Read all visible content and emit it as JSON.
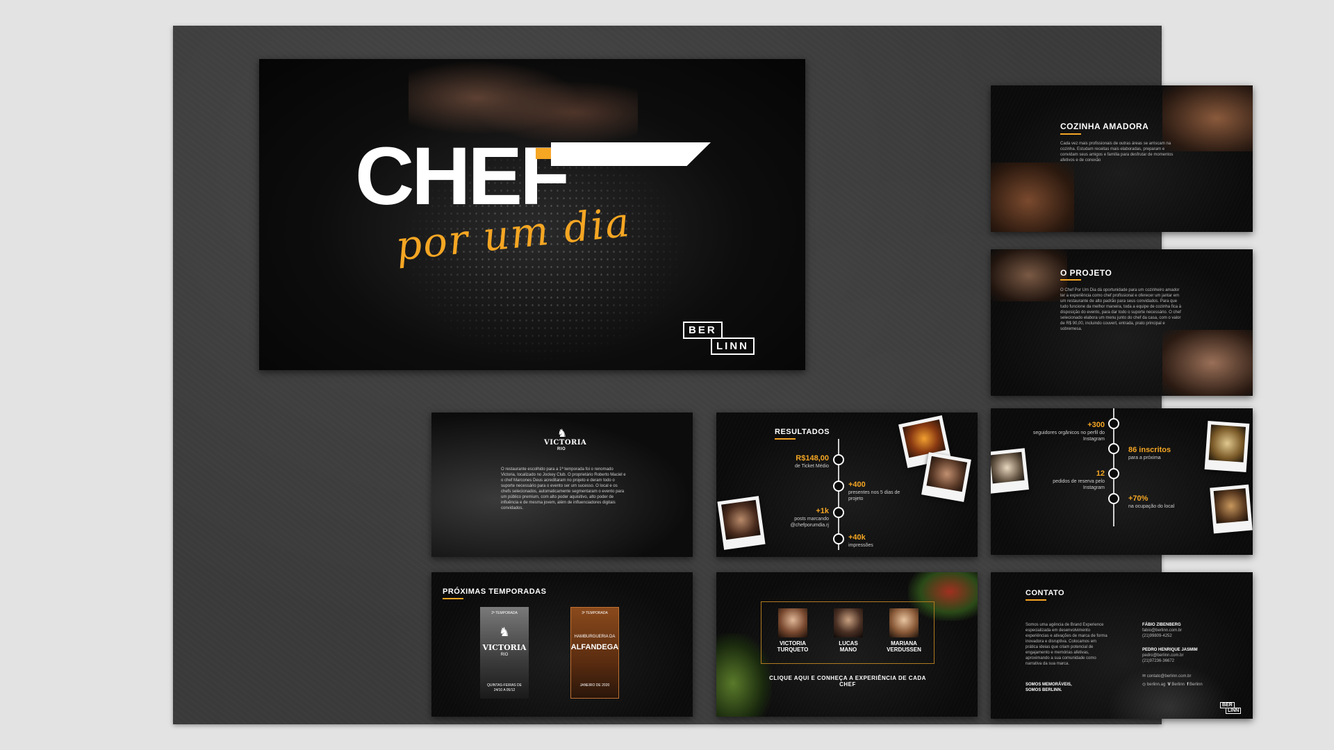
{
  "slide1": {
    "logo_word": "CHEF",
    "script_word": "por um dia",
    "brand_top": "BER",
    "brand_bottom": "LINN"
  },
  "slide2": {
    "title": "COZINHA AMADORA",
    "paragraph": "Cada vez mais profissionais de outras áreas se arriscam na cozinha. Estudam receitas mais elaboradas, preparam e convidam seus amigos e família para desfrutar de momentos afetivos e de conexão"
  },
  "slide3": {
    "title": "O PROJETO",
    "paragraph": "O Chef Por Um Dia dá oportunidade para um cozinheiro amador ter a experiência como chef profissional e oferecer um jantar em um restaurante de alto padrão para seus convidados. Para que tudo funcione da melhor maneira, toda a equipe de cozinha fica à disposição do evento, para dar todo o suporte necessário. O chef selecionado elabora um menu junto do chef da casa, com o valor de R$ 90,00, incluindo couvert, entrada, prato principal e sobremesa."
  },
  "slide4": {
    "logo": "VICTORIA",
    "logo_sub": "RIO",
    "paragraph": "O restaurante escolhido para a 1ª temporada foi o renomado Victoria, localizado no Jockey Club. O proprietário Roberto Maciel e o chef Marcones Deus acreditaram no projeto e deram todo o suporte necessário para o evento ser um sucesso. O local e os chefs selecionados, automaticamente segmentaram o evento para um público premium, com alto poder aquisitivo, alto poder de influência e de mesma jovem, além de influenciadores digitais convidados."
  },
  "slide5": {
    "title": "RESULTADOS",
    "stats": [
      {
        "big": "R$148,00",
        "small": "de Ticket Médio"
      },
      {
        "big": "+400",
        "small": "presentes nos 5 dias de projeto"
      },
      {
        "big": "+1k",
        "small": "posts marcando @chefporumdia.rj"
      },
      {
        "big": "+40k",
        "small": "impressões"
      }
    ]
  },
  "slide6": {
    "stats": [
      {
        "big": "+300",
        "small": "seguidores orgânicos no perfil do Instagram"
      },
      {
        "big": "86 inscritos",
        "small": "para a próxima"
      },
      {
        "big": "12",
        "small": "pedidos de reserva pelo Instagram"
      },
      {
        "big": "+70%",
        "small": "na ocupação do local"
      }
    ]
  },
  "slide7": {
    "title": "PRÓXIMAS TEMPORADAS",
    "poster1": {
      "season": "2ª TEMPORADA",
      "name": "VICTORIA",
      "sub": "RIO",
      "date": "QUINTAS-FEIRAS DE 24/10 A 05/12"
    },
    "poster2": {
      "season": "3ª TEMPORADA",
      "name_top": "HAMBURGUERIA DA",
      "name": "ALFANDEGA",
      "date": "JANEIRO DE 2020"
    }
  },
  "slide8": {
    "chefs": [
      {
        "first": "VICTORIA",
        "last": "TURQUETO"
      },
      {
        "first": "LUCAS",
        "last": "MANO"
      },
      {
        "first": "MARIANA",
        "last": "VERDUSSEN"
      }
    ],
    "cta": "CLIQUE AQUI E CONHEÇA A EXPERIÊNCIA DE CADA CHEF"
  },
  "slide9": {
    "title": "CONTATO",
    "paragraph": "Somos uma agência de Brand Experience especializada em desenvolvimento experiências e ativações de marca de forma inovadora e disruptiva. Colocamos em prática ideias que criam potencial de engajamento e memórias afetivas, aproximando a sua comunidade como narrativa da sua marca.",
    "tagline1": "SOMOS MEMORÁVEIS,",
    "tagline2": "SOMOS BERLINN.",
    "contact1_name": "FÁBIO ZIBENBERG",
    "contact1_email": "fabio@berlinn.com.br",
    "contact1_phone": "(21)99809-4252",
    "contact2_name": "PEDRO HENRIQUE JASMIM",
    "contact2_email": "pedro@berlinn.com.br",
    "contact2_phone": "(21)97236-36672",
    "general_email": "contato@berlinn.com.br",
    "social_instagram": "berlinn.ag",
    "social_vimeo": "Berlinn",
    "social_facebook": "Berlinn",
    "brand_top": "BER",
    "brand_bottom": "LINN"
  },
  "colors": {
    "accent": "#f5a623",
    "slide_bg": "#0b0b0b",
    "board_bg": "#3a3a3a",
    "page_bg": "#e3e3e3"
  }
}
